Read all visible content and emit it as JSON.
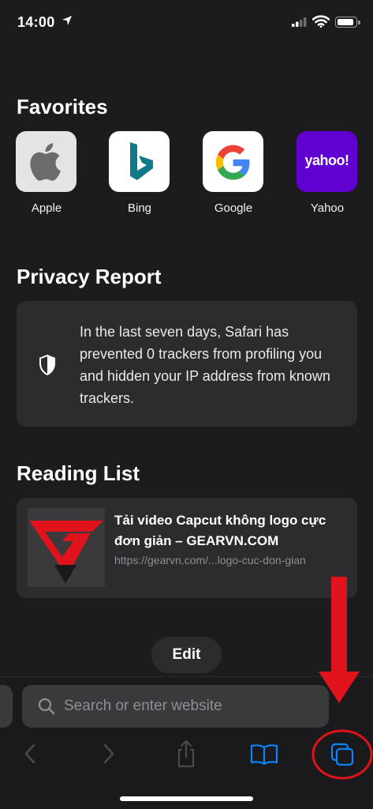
{
  "status_bar": {
    "time": "14:00"
  },
  "favorites": {
    "title": "Favorites",
    "items": [
      {
        "label": "Apple",
        "icon": "apple-icon"
      },
      {
        "label": "Bing",
        "icon": "bing-icon"
      },
      {
        "label": "Google",
        "icon": "google-icon"
      },
      {
        "label": "Yahoo",
        "icon": "yahoo-icon",
        "logo_text": "yahoo!"
      }
    ]
  },
  "privacy_report": {
    "title": "Privacy Report",
    "text": "In the last seven days, Safari has prevented 0 trackers from profiling you and hidden your IP address from known trackers."
  },
  "reading_list": {
    "title": "Reading List",
    "items": [
      {
        "title": "Tải video Capcut không logo cực đơn giản – GEARVN.COM",
        "url": "https://gearvn.com/...logo-cuc-don-gian"
      }
    ]
  },
  "edit_label": "Edit",
  "search": {
    "placeholder": "Search or enter website"
  },
  "colors": {
    "background": "#1c1c1e",
    "card": "#2c2c2e",
    "accent_blue": "#0a84ff",
    "annotation_red": "#e0121b",
    "yahoo_purple": "#6001d2",
    "bing_teal": "#008373"
  }
}
